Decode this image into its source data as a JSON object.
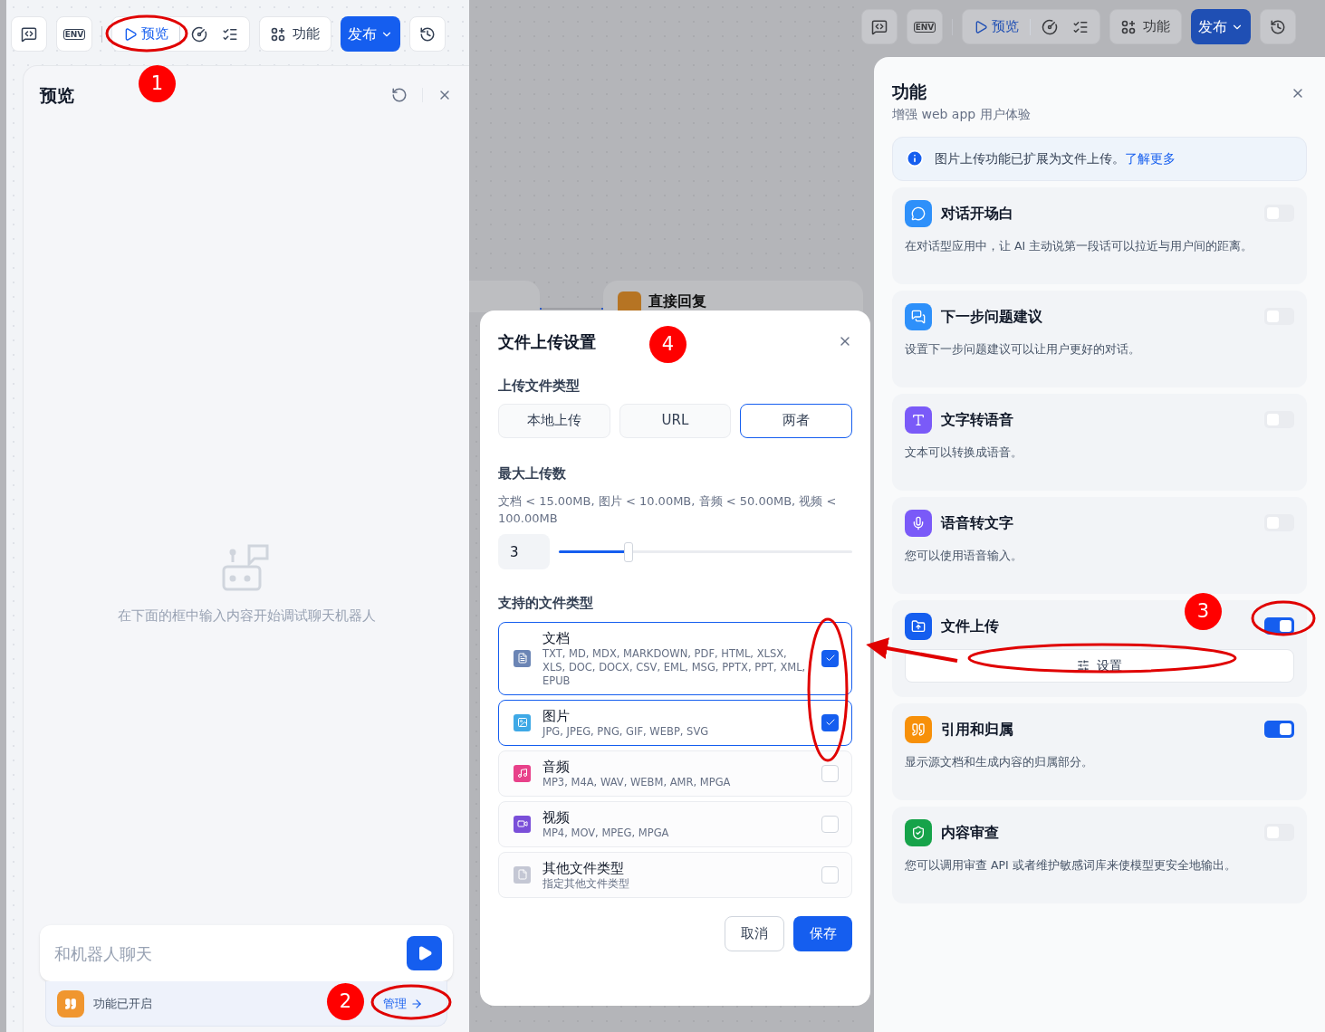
{
  "left_toolbar": {
    "env": "ENV",
    "preview": "预览",
    "features": "功能",
    "publish": "发布"
  },
  "preview_panel": {
    "title": "预览",
    "empty_text": "在下面的框中输入内容开始调试聊天机器人",
    "chat_placeholder": "和机器人聊天",
    "features_status": "功能已开启",
    "manage_link": "管理"
  },
  "canvas": {
    "node_title": "直接回复"
  },
  "right_toolbar": {
    "env": "ENV",
    "preview": "预览",
    "features": "功能",
    "publish": "发布"
  },
  "upload_dialog": {
    "title": "文件上传设置",
    "upload_type_label": "上传文件类型",
    "upload_types": [
      {
        "label": "本地上传",
        "selected": false
      },
      {
        "label": "URL",
        "selected": false
      },
      {
        "label": "两者",
        "selected": true
      }
    ],
    "max_label": "最大上传数",
    "limits": "文档 < 15.00MB, 图片 < 10.00MB, 音频 < 50.00MB, 视频 < 100.00MB",
    "max_value": "3",
    "level": 0.23,
    "file_types_label": "支持的文件类型",
    "file_types": [
      {
        "name": "文档",
        "extensions": "TXT, MD, MDX, MARKDOWN, PDF, HTML, XLSX, XLS, DOC, DOCX, CSV, EML, MSG, PPTX, PPT, XML, EPUB",
        "checked": true,
        "color": "#6b85b5"
      },
      {
        "name": "图片",
        "extensions": "JPG, JPEG, PNG, GIF, WEBP, SVG",
        "checked": true,
        "color": "#3fa9e6"
      },
      {
        "name": "音频",
        "extensions": "MP3, M4A, WAV, WEBM, AMR, MPGA",
        "checked": false,
        "color": "#e8418a"
      },
      {
        "name": "视频",
        "extensions": "MP4, MOV, MPEG, MPGA",
        "checked": false,
        "color": "#7a4fd9"
      },
      {
        "name": "其他文件类型",
        "extensions": "指定其他文件类型",
        "checked": false,
        "color": "#c4c7d4"
      }
    ],
    "cancel": "取消",
    "save": "保存"
  },
  "features_panel": {
    "title": "功能",
    "subtitle": "增强 web app 用户体验",
    "notice": "图片上传功能已扩展为文件上传。",
    "notice_link": "了解更多",
    "features": [
      {
        "title": "对话开场白",
        "description": "在对话型应用中，让 AI 主动说第一段话可以拉近与用户间的距离。",
        "on": false,
        "color": "#2e90fa"
      },
      {
        "title": "下一步问题建议",
        "description": "设置下一步问题建议可以让用户更好的对话。",
        "on": false,
        "color": "#2e90fa"
      },
      {
        "title": "文字转语音",
        "description": "文本可以转换成语音。",
        "on": false,
        "color": "#7a5af8"
      },
      {
        "title": "语音转文字",
        "description": "您可以使用语音输入。",
        "on": false,
        "color": "#7a5af8"
      },
      {
        "title": "文件上传",
        "settings": "设置",
        "on": true,
        "color": "#155eef"
      },
      {
        "title": "引用和归属",
        "description": "显示源文档和生成内容的归属部分。",
        "on": true,
        "color": "#f79009"
      },
      {
        "title": "内容审查",
        "description": "您可以调用审查 API 或者维护敏感词库来使模型更安全地输出。",
        "on": false,
        "color": "#16a34a"
      }
    ]
  },
  "annotations": [
    {
      "label": "1"
    },
    {
      "label": "2"
    },
    {
      "label": "3"
    },
    {
      "label": "4"
    }
  ]
}
